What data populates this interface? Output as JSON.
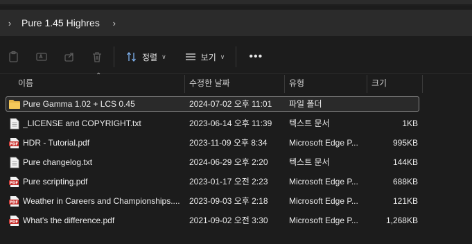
{
  "breadcrumb": {
    "folder": "Pure 1.45 Highres"
  },
  "toolbar": {
    "sort_label": "정렬",
    "view_label": "보기",
    "more_label": "•••"
  },
  "columns": {
    "name": "이름",
    "date": "수정한 날짜",
    "type": "유형",
    "size": "크기"
  },
  "files": [
    {
      "name": "Pure Gamma 1.02 + LCS 0.45",
      "date": "2024-07-02 오후 11:01",
      "type": "파일 폴더",
      "size": "",
      "icon": "folder-icon"
    },
    {
      "name": "_LICENSE and COPYRIGHT.txt",
      "date": "2023-06-14 오후 11:39",
      "type": "텍스트 문서",
      "size": "1KB",
      "icon": "text-file-icon"
    },
    {
      "name": "HDR - Tutorial.pdf",
      "date": "2023-11-09 오후 8:34",
      "type": "Microsoft Edge P...",
      "size": "995KB",
      "icon": "pdf-file-icon"
    },
    {
      "name": "Pure changelog.txt",
      "date": "2024-06-29 오후 2:20",
      "type": "텍스트 문서",
      "size": "144KB",
      "icon": "text-file-icon"
    },
    {
      "name": "Pure scripting.pdf",
      "date": "2023-01-17 오전 2:23",
      "type": "Microsoft Edge P...",
      "size": "688KB",
      "icon": "pdf-file-icon"
    },
    {
      "name": "Weather in Careers and Championships....",
      "date": "2023-09-03 오후 2:18",
      "type": "Microsoft Edge P...",
      "size": "121KB",
      "icon": "pdf-file-icon"
    },
    {
      "name": "What's the difference.pdf",
      "date": "2021-09-02 오전 3:30",
      "type": "Microsoft Edge P...",
      "size": "1,268KB",
      "icon": "pdf-file-icon"
    }
  ],
  "colors": {
    "background": "#1c1c1c",
    "folder": "#e8b84a",
    "pdf": "#c9302c",
    "selection_border": "#8a8a8a"
  }
}
